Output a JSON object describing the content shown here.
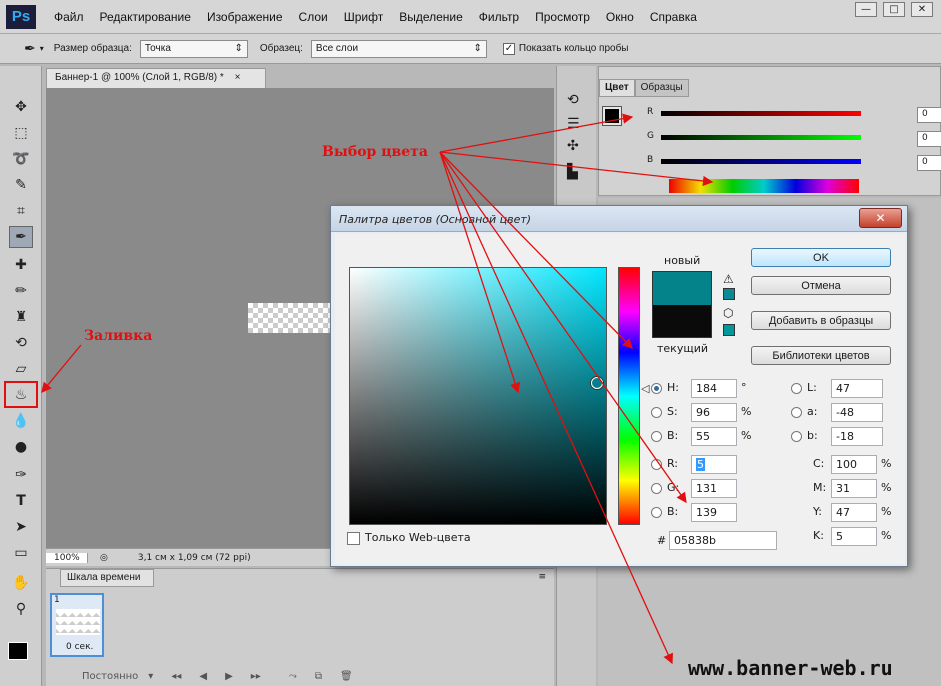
{
  "app": {
    "logo": "Ps",
    "menu": [
      "Файл",
      "Редактирование",
      "Изображение",
      "Слои",
      "Шрифт",
      "Выделение",
      "Фильтр",
      "Просмотр",
      "Окно",
      "Справка"
    ]
  },
  "options": {
    "sample_size_label": "Размер образца:",
    "sample_size_value": "Точка",
    "sample_label": "Образец:",
    "sample_value": "Все слои",
    "show_ring_label": "Показать кольцо пробы"
  },
  "document": {
    "tab_title": "Баннер-1 @ 100% (Слой 1, RGB/8) *",
    "tab_close": "×",
    "zoom": "100%",
    "info": "3,1 см x 1,09 см (72 ppi)"
  },
  "timeline": {
    "tab": "Шкала времени",
    "frame_number": "1",
    "frame_delay": "0 сек.",
    "loop_mode": "Постоянно"
  },
  "color_panel": {
    "tabs": [
      "Цвет",
      "Образцы"
    ],
    "r_label": "R",
    "g_label": "G",
    "b_label": "B",
    "r_value": "0",
    "g_value": "0",
    "b_value": "0"
  },
  "dialog": {
    "title": "Палитра цветов (Основной цвет)",
    "close": "✕",
    "new_label": "новый",
    "current_label": "текущий",
    "buttons": {
      "ok": "OK",
      "cancel": "Отмена",
      "add_swatches": "Добавить в образцы",
      "libraries": "Библиотеки цветов"
    },
    "hsb": {
      "h_label": "H:",
      "h_value": "184",
      "h_unit": "°",
      "s_label": "S:",
      "s_value": "96",
      "s_unit": "%",
      "b_label": "B:",
      "b_value": "55",
      "b_unit": "%"
    },
    "rgb": {
      "r_label": "R:",
      "r_value": "5",
      "g_label": "G:",
      "g_value": "131",
      "b_label": "B:",
      "b_value": "139"
    },
    "lab": {
      "l_label": "L:",
      "l_value": "47",
      "a_label": "a:",
      "a_value": "-48",
      "b_label": "b:",
      "b_value": "-18"
    },
    "cmyk": {
      "c_label": "C:",
      "c_value": "100",
      "c_unit": "%",
      "m_label": "M:",
      "m_value": "31",
      "m_unit": "%",
      "y_label": "Y:",
      "y_value": "47",
      "y_unit": "%",
      "k_label": "K:",
      "k_value": "5",
      "k_unit": "%"
    },
    "hex_label": "#",
    "hex_value": "05838b",
    "web_only_label": "Только Web-цвета",
    "new_color": "#05838b",
    "current_color": "#000000"
  },
  "annotations": {
    "color_select": "Выбор цвета",
    "fill": "Заливка",
    "watermark": "www.banner-web.ru"
  }
}
